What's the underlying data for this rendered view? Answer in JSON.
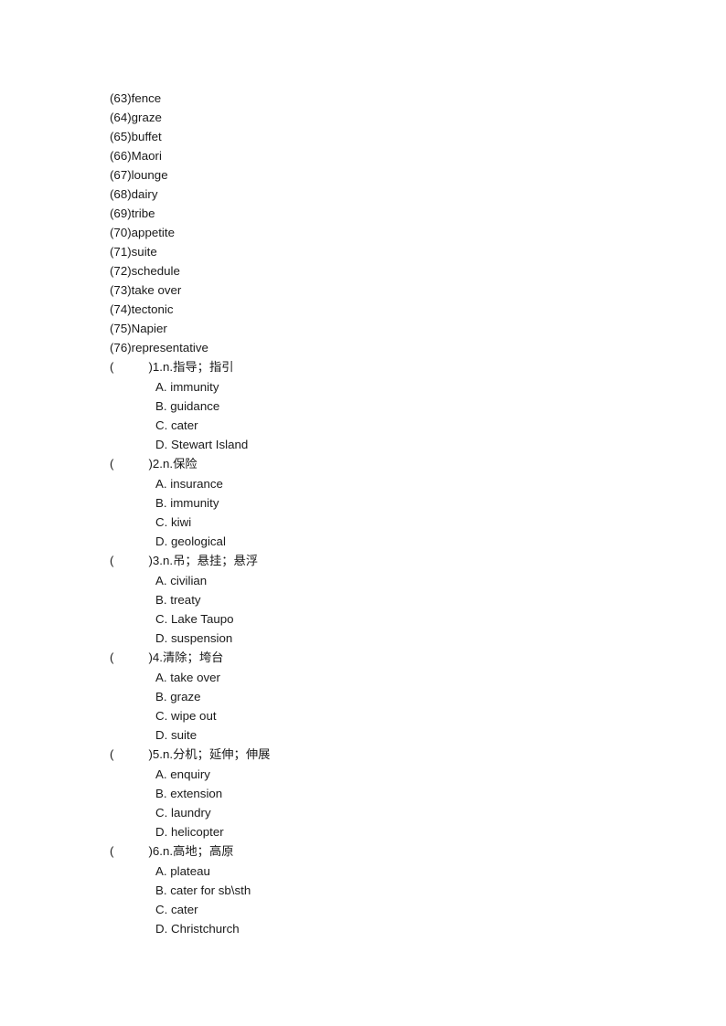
{
  "document": {
    "page_background": "#ffffff",
    "text_color": "#1a1a1a"
  },
  "vocabulary": {
    "items": [
      {
        "number": "(63)",
        "word": "fence"
      },
      {
        "number": "(64)",
        "word": "graze"
      },
      {
        "number": "(65)",
        "word": "buffet"
      },
      {
        "number": "(66)",
        "word": "Maori"
      },
      {
        "number": "(67)",
        "word": "lounge"
      },
      {
        "number": "(68)",
        "word": "dairy"
      },
      {
        "number": "(69)",
        "word": "tribe"
      },
      {
        "number": "(70)",
        "word": "appetite"
      },
      {
        "number": "(71)",
        "word": "suite"
      },
      {
        "number": "(72)",
        "word": "schedule"
      },
      {
        "number": "(73)",
        "word": "take over"
      },
      {
        "number": "(74)",
        "word": "tectonic"
      },
      {
        "number": "(75)",
        "word": "Napier"
      },
      {
        "number": "(76)",
        "word": "representative"
      }
    ]
  },
  "questions": {
    "paren_open": "(",
    "paren_close": ")",
    "items": [
      {
        "index": "1.",
        "pos": "n.",
        "prompt": "指导；指引",
        "options": [
          {
            "letter": "A.",
            "text": "immunity"
          },
          {
            "letter": "B.",
            "text": "guidance"
          },
          {
            "letter": "C.",
            "text": "cater"
          },
          {
            "letter": "D.",
            "text": "Stewart Island"
          }
        ]
      },
      {
        "index": "2.",
        "pos": "n.",
        "prompt": "保险",
        "options": [
          {
            "letter": "A.",
            "text": "insurance"
          },
          {
            "letter": "B.",
            "text": "immunity"
          },
          {
            "letter": "C.",
            "text": "kiwi"
          },
          {
            "letter": "D.",
            "text": "geological"
          }
        ]
      },
      {
        "index": "3.",
        "pos": "n.",
        "prompt": "吊；悬挂；悬浮",
        "options": [
          {
            "letter": "A.",
            "text": "civilian"
          },
          {
            "letter": "B.",
            "text": "treaty"
          },
          {
            "letter": "C.",
            "text": "Lake Taupo"
          },
          {
            "letter": "D.",
            "text": "suspension"
          }
        ]
      },
      {
        "index": "4.",
        "pos": "",
        "prompt": "清除；垮台",
        "options": [
          {
            "letter": "A.",
            "text": "take over"
          },
          {
            "letter": "B.",
            "text": "graze"
          },
          {
            "letter": "C.",
            "text": "wipe out"
          },
          {
            "letter": "D.",
            "text": "suite"
          }
        ]
      },
      {
        "index": "5.",
        "pos": "n.",
        "prompt": "分机；延伸；伸展",
        "options": [
          {
            "letter": "A.",
            "text": "enquiry"
          },
          {
            "letter": "B.",
            "text": "extension"
          },
          {
            "letter": "C.",
            "text": "laundry"
          },
          {
            "letter": "D.",
            "text": "helicopter"
          }
        ]
      },
      {
        "index": "6.",
        "pos": "n.",
        "prompt": "高地；高原",
        "options": [
          {
            "letter": "A.",
            "text": "plateau"
          },
          {
            "letter": "B.",
            "text": "cater for sb\\sth"
          },
          {
            "letter": "C.",
            "text": "cater"
          },
          {
            "letter": "D.",
            "text": "Christchurch"
          }
        ]
      }
    ]
  }
}
